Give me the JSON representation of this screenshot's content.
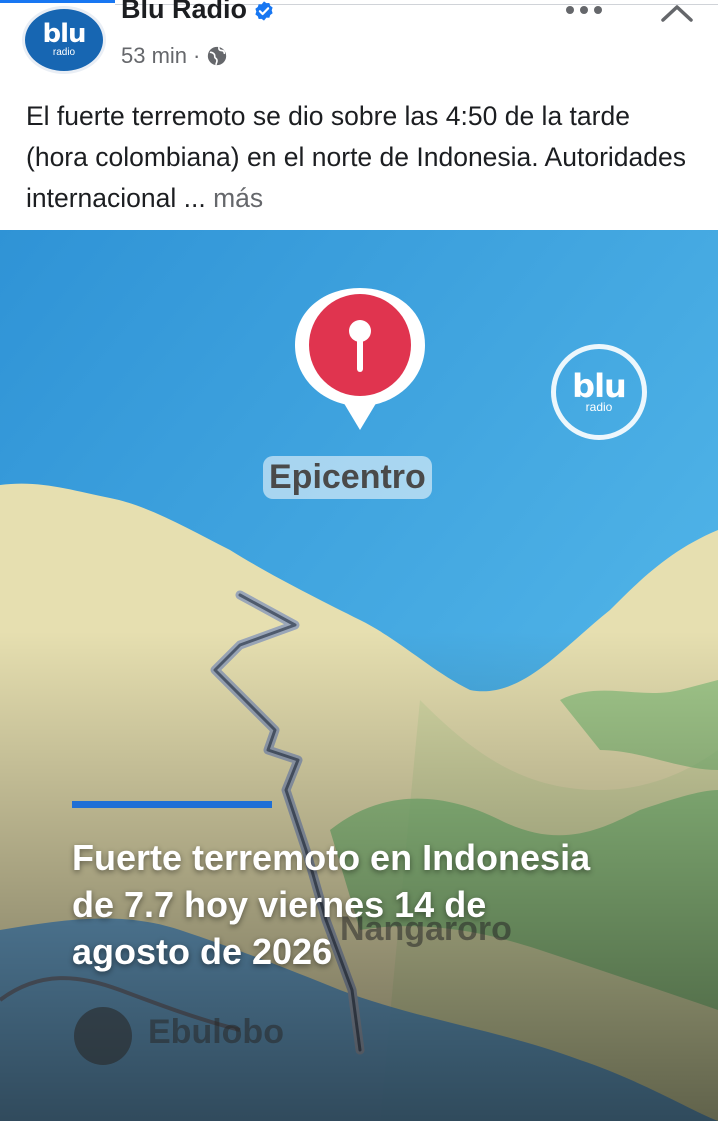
{
  "post": {
    "page_name": "Blu Radio",
    "avatar_logo": "blu",
    "avatar_logo_sub": "radio",
    "time": "53 min",
    "separator": "·",
    "text": "El fuerte terremoto se dio sobre las 4:50 de la tarde (hora colombiana) en el norte de Indonesia. Autoridades internacional ...",
    "see_more": "más"
  },
  "icons": {
    "verified": "verified-badge-icon",
    "audience": "globe-icon",
    "more": "more-options-icon",
    "close": "close-icon"
  },
  "media": {
    "pin_label": "Epicentro",
    "watermark_logo": "blu",
    "watermark_sub": "radio",
    "place_labels": [
      "Nangaroro",
      "Ebulobo"
    ],
    "headline": "Fuerte terremoto en Indonesia de 7.7 hoy viernes 14 de agosto de 2026"
  },
  "colors": {
    "brand_blue": "#1766b2",
    "accent_bar": "#1f6fd6",
    "pin_red": "#e0344f",
    "sea": "#3aa3e0",
    "land": "#e6dfb0"
  }
}
